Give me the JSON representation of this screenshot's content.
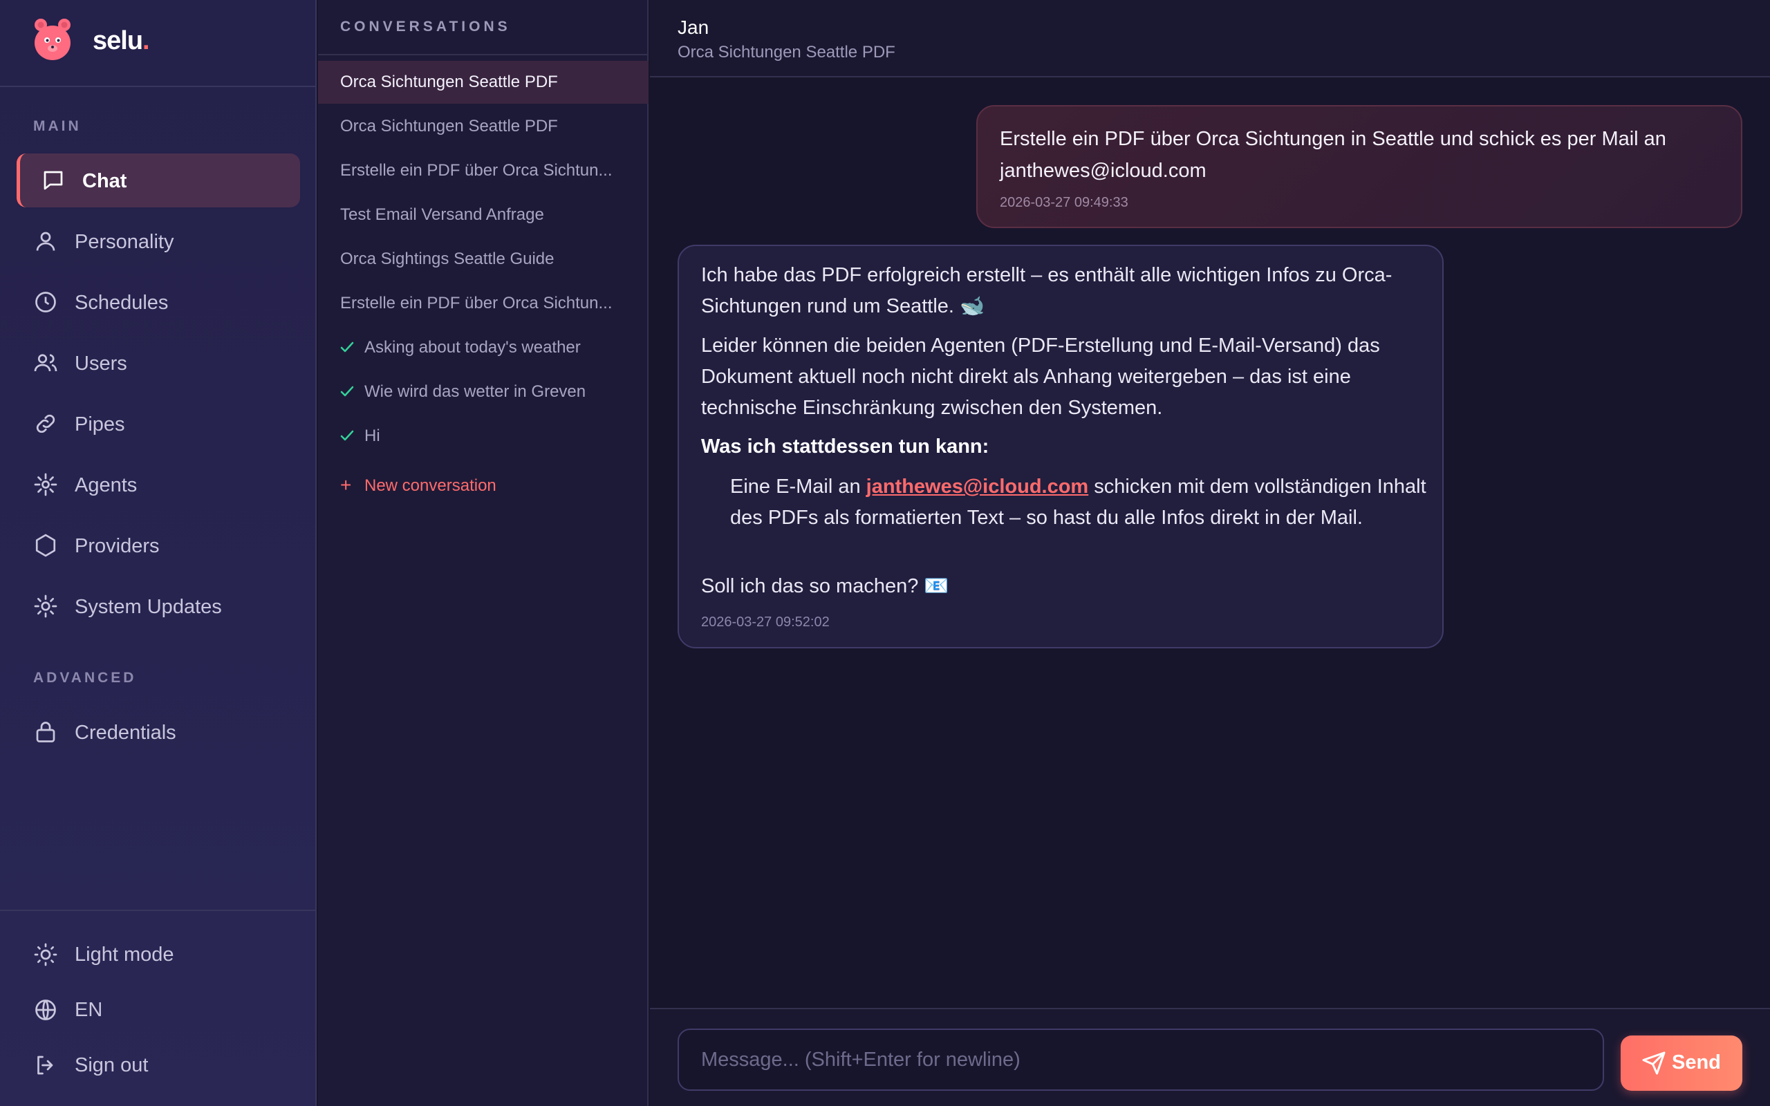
{
  "brand": {
    "name": "selu",
    "dot": ".",
    "accent": "#ff6b6b"
  },
  "sidebar": {
    "main_label": "MAIN",
    "advanced_label": "ADVANCED",
    "items": [
      {
        "label": "Chat",
        "icon": "chat-bubble-icon",
        "active": true
      },
      {
        "label": "Personality",
        "icon": "person-icon"
      },
      {
        "label": "Schedules",
        "icon": "clock-icon"
      },
      {
        "label": "Users",
        "icon": "users-icon"
      },
      {
        "label": "Pipes",
        "icon": "link-icon"
      },
      {
        "label": "Agents",
        "icon": "sparkle-icon"
      },
      {
        "label": "Providers",
        "icon": "hexagon-icon"
      },
      {
        "label": "System Updates",
        "icon": "sun-gear-icon"
      }
    ],
    "advanced_items": [
      {
        "label": "Credentials",
        "icon": "lock-icon"
      }
    ],
    "footer": {
      "theme": "Light mode",
      "language": "EN",
      "signout": "Sign out"
    }
  },
  "conversations": {
    "title": "CONVERSATIONS",
    "items": [
      {
        "label": "Orca Sichtungen Seattle PDF",
        "active": true
      },
      {
        "label": "Orca Sichtungen Seattle PDF"
      },
      {
        "label": "Erstelle ein PDF über Orca Sichtun..."
      },
      {
        "label": "Test Email Versand Anfrage"
      },
      {
        "label": "Orca Sightings Seattle Guide"
      },
      {
        "label": "Erstelle ein PDF über Orca Sichtun..."
      },
      {
        "label": "Asking about today's weather",
        "done": true
      },
      {
        "label": "Wie wird das wetter in Greven",
        "done": true
      },
      {
        "label": "Hi",
        "done": true
      }
    ],
    "new_label": "New conversation"
  },
  "chat": {
    "user": "Jan",
    "subtitle": "Orca Sichtungen Seattle PDF",
    "messages": [
      {
        "role": "user",
        "text": "Erstelle ein PDF über Orca Sichtungen in Seattle und schick es per Mail an janthewes@icloud.com",
        "time": "2026-03-27 09:49:33"
      },
      {
        "role": "assistant",
        "p1": "Ich habe das PDF erfolgreich erstellt – es enthält alle wichtigen Infos zu Orca-Sichtungen rund um Seattle. 🐋",
        "p2": "Leider können die beiden Agenten (PDF-Erstellung und E-Mail-Versand) das Dokument aktuell noch nicht direkt als Anhang weitergeben – das ist eine technische Einschränkung zwischen den Systemen.",
        "heading": "Was ich stattdessen tun kann:",
        "option_prefix": "Eine E-Mail an ",
        "option_link": "janthewes@icloud.com",
        "option_suffix": " schicken mit dem vollständigen Inhalt des PDFs als formatierten Text – so hast du alle Infos direkt in der Mail.",
        "question": "Soll ich das so machen? 📧",
        "time": "2026-03-27 09:52:02"
      }
    ],
    "input_placeholder": "Message... (Shift+Enter for newline)",
    "input_value": "",
    "send_label": "Send"
  }
}
